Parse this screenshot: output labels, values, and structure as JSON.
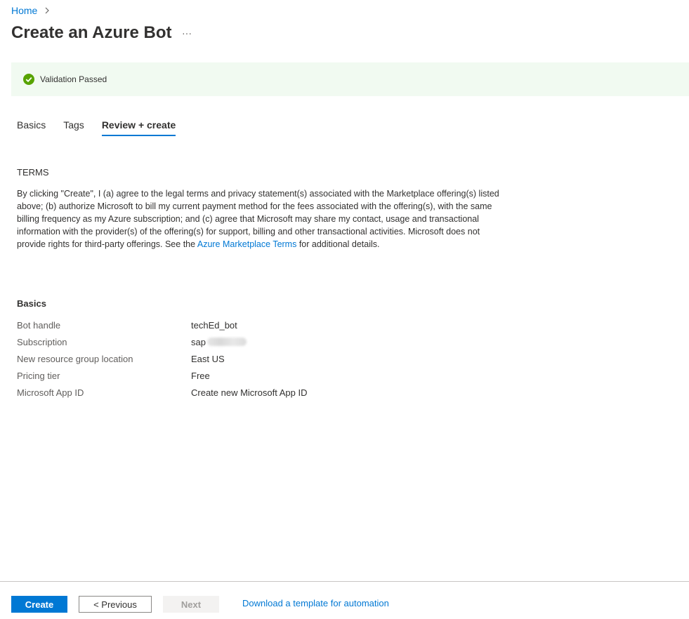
{
  "breadcrumb": {
    "home": "Home"
  },
  "header": {
    "title": "Create an Azure Bot",
    "more": "···"
  },
  "validation": {
    "text": "Validation Passed",
    "color": "#57a300"
  },
  "tabs": [
    {
      "label": "Basics",
      "active": false
    },
    {
      "label": "Tags",
      "active": false
    },
    {
      "label": "Review + create",
      "active": true
    }
  ],
  "terms": {
    "heading": "TERMS",
    "text_before": "By clicking \"Create\", I (a) agree to the legal terms and privacy statement(s) associated with the Marketplace offering(s) listed above; (b) authorize Microsoft to bill my current payment method for the fees associated with the offering(s), with the same billing frequency as my Azure subscription; and (c) agree that Microsoft may share my contact, usage and transactional information with the provider(s) of the offering(s) for support, billing and other transactional activities. Microsoft does not provide rights for third-party offerings. See the ",
    "link": "Azure Marketplace Terms",
    "text_after": " for additional details."
  },
  "basics": {
    "heading": "Basics",
    "rows": [
      {
        "label": "Bot handle",
        "value": "techEd_bot"
      },
      {
        "label": "Subscription",
        "value": "sap"
      },
      {
        "label": "New resource group location",
        "value": "East US"
      },
      {
        "label": "Pricing tier",
        "value": "Free"
      },
      {
        "label": "Microsoft App ID",
        "value": "Create new Microsoft App ID"
      }
    ]
  },
  "footer": {
    "create": "Create",
    "previous": "< Previous",
    "next": "Next",
    "download_link": "Download a template for automation"
  },
  "colors": {
    "accent": "#0078d4",
    "success_bg": "#f1faf1"
  }
}
